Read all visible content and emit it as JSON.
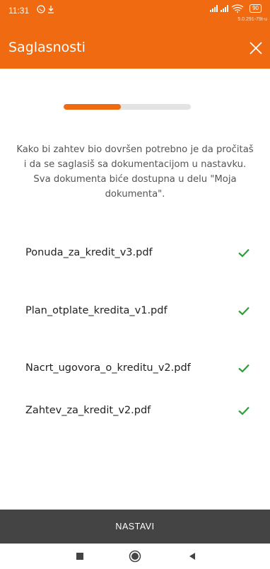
{
  "status_bar": {
    "time": "11:31",
    "battery": "90",
    "version": "5.0.291-79t-u"
  },
  "header": {
    "title": "Saglasnosti"
  },
  "progress": {
    "fraction": 0.45
  },
  "intro_text": "Kako bi zahtev bio dovršen potrebno je da pročitaš i da se saglasiš sa dokumentacijom u nastavku. Sva dokumenta biće dostupna u delu \"Moja dokumenta\".",
  "documents": [
    {
      "name": "Ponuda_za_kredit_v3.pdf",
      "accepted": true
    },
    {
      "name": "Plan_otplate_kredita_v1.pdf",
      "accepted": true
    },
    {
      "name": "Nacrt_ugovora_o_kreditu_v2.pdf",
      "accepted": true
    },
    {
      "name": "Zahtev_za_kredit_v2.pdf",
      "accepted": true
    }
  ],
  "footer": {
    "continue_label": "NASTAVI"
  },
  "colors": {
    "accent": "#ef6a11",
    "check": "#2e9e3a",
    "footer": "#444444"
  }
}
